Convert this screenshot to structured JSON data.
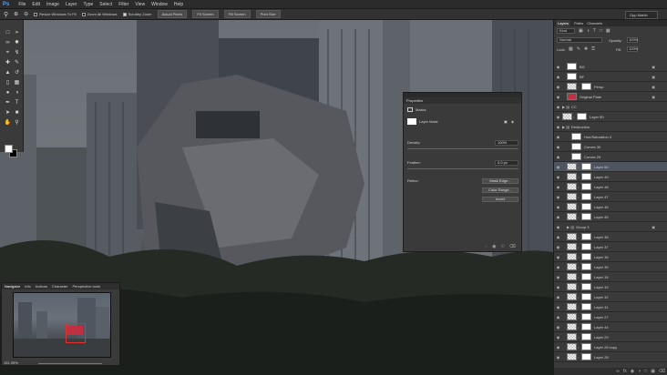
{
  "app": {
    "logo": "Ps"
  },
  "menu": [
    "File",
    "Edit",
    "Image",
    "Layer",
    "Type",
    "Select",
    "Filter",
    "View",
    "Window",
    "Help"
  ],
  "options": {
    "resize_windows": "Resize Windows To Fit",
    "zoom_all": "Zoom All Windows",
    "scrubby_zoom": "Scrubby Zoom",
    "actual_pixels": "Actual Pixels",
    "fit_screen": "Fit Screen",
    "fill_screen": "Fill Screen",
    "print_size": "Print Size",
    "workspace": "Gpp Martin"
  },
  "properties": {
    "header": "Properties",
    "tab": "Masks",
    "mask_label": "Layer Mask",
    "density_label": "Density:",
    "density_value": "100%",
    "feather_label": "Feather:",
    "feather_value": "0.0 px",
    "refine_label": "Refine:",
    "mask_edge": "Mask Edge...",
    "color_range": "Color Range...",
    "invert": "Invert"
  },
  "navigator": {
    "tabs": [
      "Navigator",
      "Info",
      "Actions",
      "Character",
      "Perspective tools"
    ],
    "zoom": "151.39%"
  },
  "layers_panel": {
    "tabs": [
      "Layers",
      "Paths",
      "Channels"
    ],
    "kind": "Kind",
    "blend_mode": "Normal",
    "opacity_label": "Opacity:",
    "opacity_value": "100%",
    "lock_label": "Lock:",
    "fill_label": "Fill:",
    "fill_value": "100%",
    "layers": [
      {
        "name": "BG",
        "thumb": "white",
        "indent": 1,
        "lock": true
      },
      {
        "name": "BF",
        "thumb": "white",
        "indent": 1,
        "lock": true
      },
      {
        "name": "Persp",
        "thumb": "check",
        "indent": 1,
        "lock": true
      },
      {
        "name": "Original Plate",
        "thumb": "red",
        "indent": 1,
        "lock": true
      },
      {
        "name": "CC",
        "thumb": "folder",
        "indent": 0,
        "lock": false
      },
      {
        "name": "Layer 50",
        "thumb": "check",
        "indent": 0,
        "lock": false
      },
      {
        "name": "Destruction",
        "thumb": "folder",
        "indent": 0,
        "lock": false
      },
      {
        "name": "Hue/Saturation 4",
        "thumb": "white",
        "indent": 2,
        "lock": false
      },
      {
        "name": "Curves 30",
        "thumb": "white",
        "indent": 2,
        "lock": false
      },
      {
        "name": "Curves 29",
        "thumb": "white",
        "indent": 2,
        "lock": false
      },
      {
        "name": "Layer 50",
        "thumb": "check",
        "indent": 1,
        "lock": false,
        "selected": true
      },
      {
        "name": "Layer 49",
        "thumb": "check",
        "indent": 1,
        "lock": false
      },
      {
        "name": "Layer 48",
        "thumb": "check",
        "indent": 1,
        "lock": false
      },
      {
        "name": "Layer 47",
        "thumb": "check",
        "indent": 1,
        "lock": false
      },
      {
        "name": "Layer 46",
        "thumb": "check",
        "indent": 1,
        "lock": false
      },
      {
        "name": "Layer 45",
        "thumb": "check",
        "indent": 1,
        "lock": false
      },
      {
        "name": "Group 3",
        "thumb": "folder",
        "indent": 1,
        "lock": true
      },
      {
        "name": "Layer 38",
        "thumb": "check",
        "indent": 1,
        "lock": false
      },
      {
        "name": "Layer 37",
        "thumb": "check",
        "indent": 1,
        "lock": false
      },
      {
        "name": "Layer 36",
        "thumb": "check",
        "indent": 1,
        "lock": false
      },
      {
        "name": "Layer 35",
        "thumb": "check",
        "indent": 1,
        "lock": false
      },
      {
        "name": "Layer 34",
        "thumb": "check",
        "indent": 1,
        "lock": false
      },
      {
        "name": "Layer 33",
        "thumb": "check",
        "indent": 1,
        "lock": false
      },
      {
        "name": "Layer 32",
        "thumb": "check",
        "indent": 1,
        "lock": false
      },
      {
        "name": "Layer 31",
        "thumb": "check",
        "indent": 1,
        "lock": false
      },
      {
        "name": "Layer 27",
        "thumb": "check",
        "indent": 1,
        "lock": false
      },
      {
        "name": "Layer 44",
        "thumb": "check",
        "indent": 1,
        "lock": false
      },
      {
        "name": "Layer 29",
        "thumb": "check",
        "indent": 1,
        "lock": false
      },
      {
        "name": "Layer 28 copy",
        "thumb": "check",
        "indent": 1,
        "lock": false
      },
      {
        "name": "Layer 28",
        "thumb": "check",
        "indent": 1,
        "lock": false
      }
    ]
  }
}
